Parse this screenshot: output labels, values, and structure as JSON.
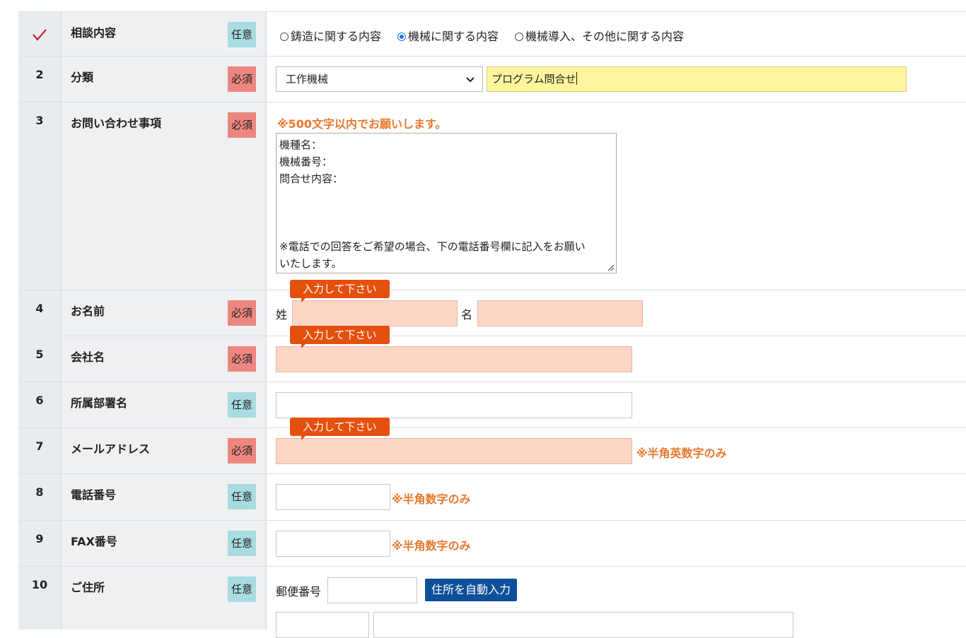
{
  "rows": [
    {
      "num_icon": "checkmark-icon",
      "label": "相談内容",
      "badge": "任意"
    },
    {
      "num": "2",
      "label": "分類",
      "badge": "必須"
    },
    {
      "num": "3",
      "label": "お問い合わせ事項",
      "badge": "必須"
    },
    {
      "num": "4",
      "label": "お名前",
      "badge": "必須"
    },
    {
      "num": "5",
      "label": "会社名",
      "badge": "必須"
    },
    {
      "num": "6",
      "label": "所属部署名",
      "badge": "任意"
    },
    {
      "num": "7",
      "label": "メールアドレス",
      "badge": "必須"
    },
    {
      "num": "8",
      "label": "電話番号",
      "badge": "任意"
    },
    {
      "num": "9",
      "label": "FAX番号",
      "badge": "任意"
    },
    {
      "num": "10",
      "label": "ご住所",
      "badge": "任意"
    }
  ],
  "consult": {
    "options": [
      "鋳造に関する内容",
      "機械に関する内容",
      "機械導入、その他に関する内容"
    ],
    "selected_index": 1
  },
  "category": {
    "select_value": "工作機械",
    "text_value": "プログラム問合せ"
  },
  "inquiry": {
    "note": "※500文字以内でお願いします。",
    "line1": "機種名：",
    "line2": "機械番号：",
    "line3": "問合せ内容：",
    "line4": "※電話での回答をご希望の場合、下の電話番号欄に記入をお願い",
    "line5": "いたします。"
  },
  "name": {
    "sei_label": "姓",
    "mei_label": "名"
  },
  "tooltip_text": "入力して下さい",
  "email_note": "※半角英数字のみ",
  "phone_note": "※半角数字のみ",
  "fax_note": "※半角数字のみ",
  "address": {
    "zip_label": "郵便番号",
    "auto_button": "住所を自動入力"
  },
  "colors": {
    "required_badge": "#ee8680",
    "optional_badge": "#a8dce0",
    "error_field": "#fdd6c6",
    "tooltip": "#e4500e",
    "note": "#e8782e",
    "highlight_field": "#fff59d",
    "button": "#0e4f99"
  }
}
